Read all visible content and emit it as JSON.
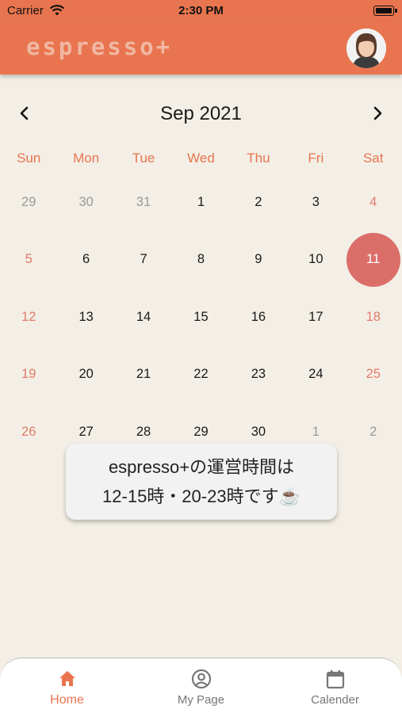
{
  "status_bar": {
    "carrier": "Carrier",
    "time": "2:30 PM"
  },
  "header": {
    "logo": "espresso+",
    "accent_color": "#e8754f"
  },
  "calendar": {
    "month_label": "Sep 2021",
    "weekdays": [
      "Sun",
      "Mon",
      "Tue",
      "Wed",
      "Thu",
      "Fri",
      "Sat"
    ],
    "weeks": [
      [
        "29",
        "30",
        "31",
        "1",
        "2",
        "3",
        "4"
      ],
      [
        "5",
        "6",
        "7",
        "8",
        "9",
        "10",
        "11"
      ],
      [
        "12",
        "13",
        "14",
        "15",
        "16",
        "17",
        "18"
      ],
      [
        "19",
        "20",
        "21",
        "22",
        "23",
        "24",
        "25"
      ],
      [
        "26",
        "27",
        "28",
        "29",
        "30",
        "1",
        "2"
      ]
    ],
    "selected_day": "11",
    "selected_color": "#dc6e6a"
  },
  "toast": {
    "line1": "espresso+の運営時間は",
    "line2": "12-15時・20-23時です☕"
  },
  "tabs": [
    {
      "label": "Home",
      "icon": "home-icon",
      "active": true
    },
    {
      "label": "My Page",
      "icon": "user-circle-icon",
      "active": false
    },
    {
      "label": "Calender",
      "icon": "calendar-icon",
      "active": false
    }
  ]
}
